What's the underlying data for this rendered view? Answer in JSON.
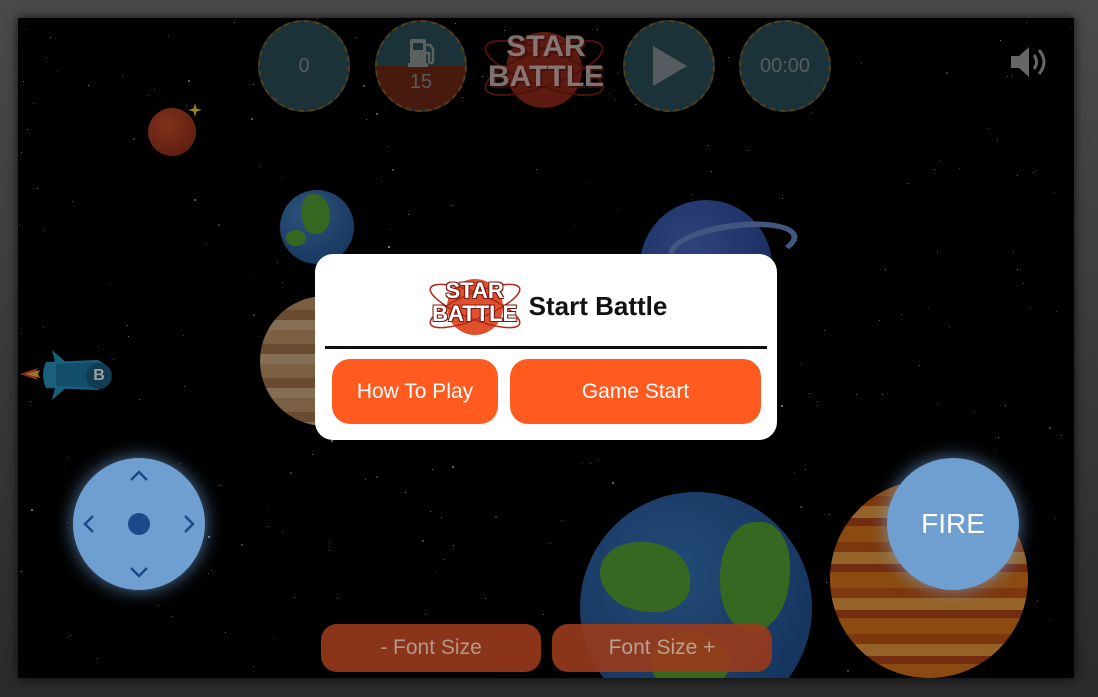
{
  "hud": {
    "score": "0",
    "fuel": "15",
    "timer": "00:00",
    "logo_line1": "STAR",
    "logo_line2": "BATTLE",
    "play_icon": "play-icon",
    "fuel_icon": "fuel-pump-icon",
    "sound_icon": "speaker-volume-icon"
  },
  "modal": {
    "logo_line1": "STAR",
    "logo_line2": "BATTLE",
    "title": "Start Battle",
    "how_to_play": "How To Play",
    "game_start": "Game Start"
  },
  "controls": {
    "fire_label": "FIRE",
    "font_decrease": "- Font Size",
    "font_increase": "Font Size +"
  },
  "ship": {
    "badge": "B"
  },
  "colors": {
    "accent": "#ff5a20",
    "hud": "#3d6e7c",
    "control": "#6f9fd0",
    "logo_red": "#d9412a"
  }
}
